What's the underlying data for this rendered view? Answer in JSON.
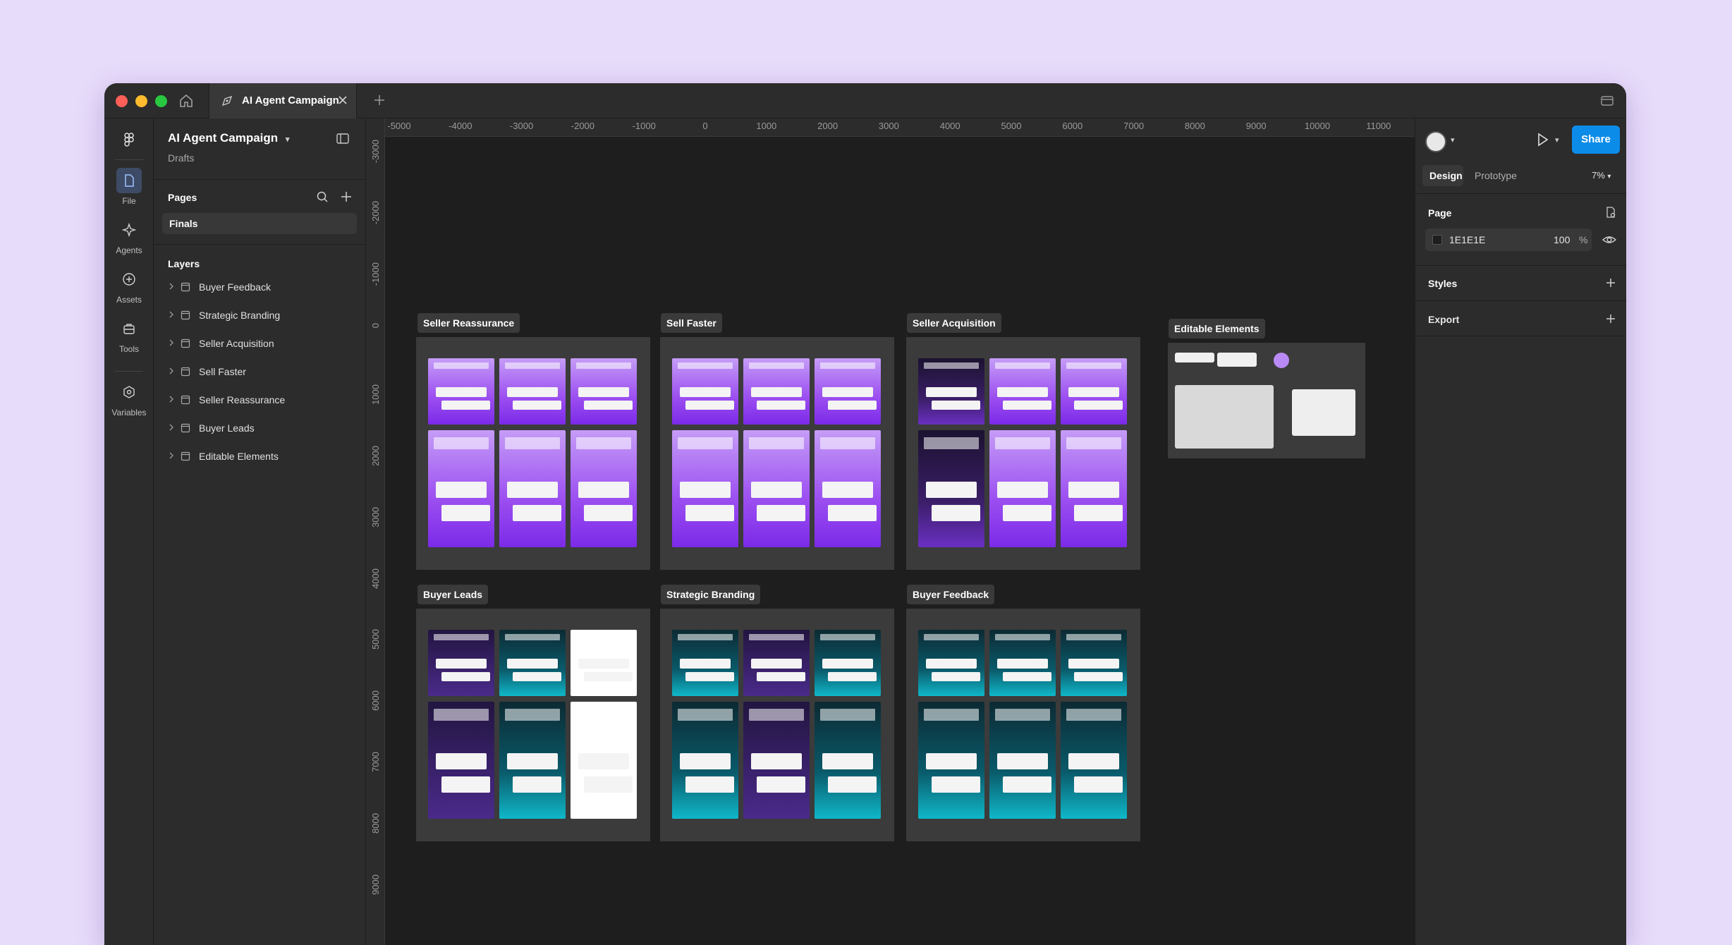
{
  "window": {
    "tab_title": "AI Agent Campaign"
  },
  "rail": {
    "items": [
      {
        "label": "File"
      },
      {
        "label": "Agents"
      },
      {
        "label": "Assets"
      },
      {
        "label": "Tools"
      },
      {
        "label": "Variables"
      }
    ]
  },
  "left_panel": {
    "project_title": "AI Agent Campaign",
    "project_location": "Drafts",
    "pages_heading": "Pages",
    "current_page": "Finals",
    "layers_heading": "Layers",
    "layers": [
      "Buyer Feedback",
      "Strategic Branding",
      "Seller Acquisition",
      "Sell Faster",
      "Seller Reassurance",
      "Buyer Leads",
      "Editable Elements"
    ]
  },
  "right_panel": {
    "share_label": "Share",
    "tabs": [
      "Design",
      "Prototype"
    ],
    "zoom": "7%",
    "page_heading": "Page",
    "page_color": "1E1E1E",
    "page_opacity": "100",
    "percent": "%",
    "styles_heading": "Styles",
    "export_heading": "Export",
    "accent_color": "#0c8ce9"
  },
  "canvas": {
    "background": "#1e1e1e",
    "ruler_x": [
      "-5000",
      "-4000",
      "-3000",
      "-2000",
      "-1000",
      "0",
      "1000",
      "2000",
      "3000",
      "4000",
      "5000",
      "6000",
      "7000",
      "8000",
      "9000",
      "10000",
      "11000"
    ],
    "ruler_y": [
      "-3000",
      "-2000",
      "-1000",
      "0",
      "1000",
      "2000",
      "3000",
      "4000",
      "5000",
      "6000",
      "7000",
      "8000",
      "9000"
    ],
    "frames": [
      {
        "name": "Seller Reassurance",
        "style": "purple"
      },
      {
        "name": "Sell Faster",
        "style": "purple"
      },
      {
        "name": "Seller Acquisition",
        "style": "mixed"
      },
      {
        "name": "Editable Elements",
        "style": "elements"
      },
      {
        "name": "Buyer Leads",
        "style": "leads"
      },
      {
        "name": "Strategic Branding",
        "style": "teal-violet"
      },
      {
        "name": "Buyer Feedback",
        "style": "teal"
      }
    ]
  }
}
